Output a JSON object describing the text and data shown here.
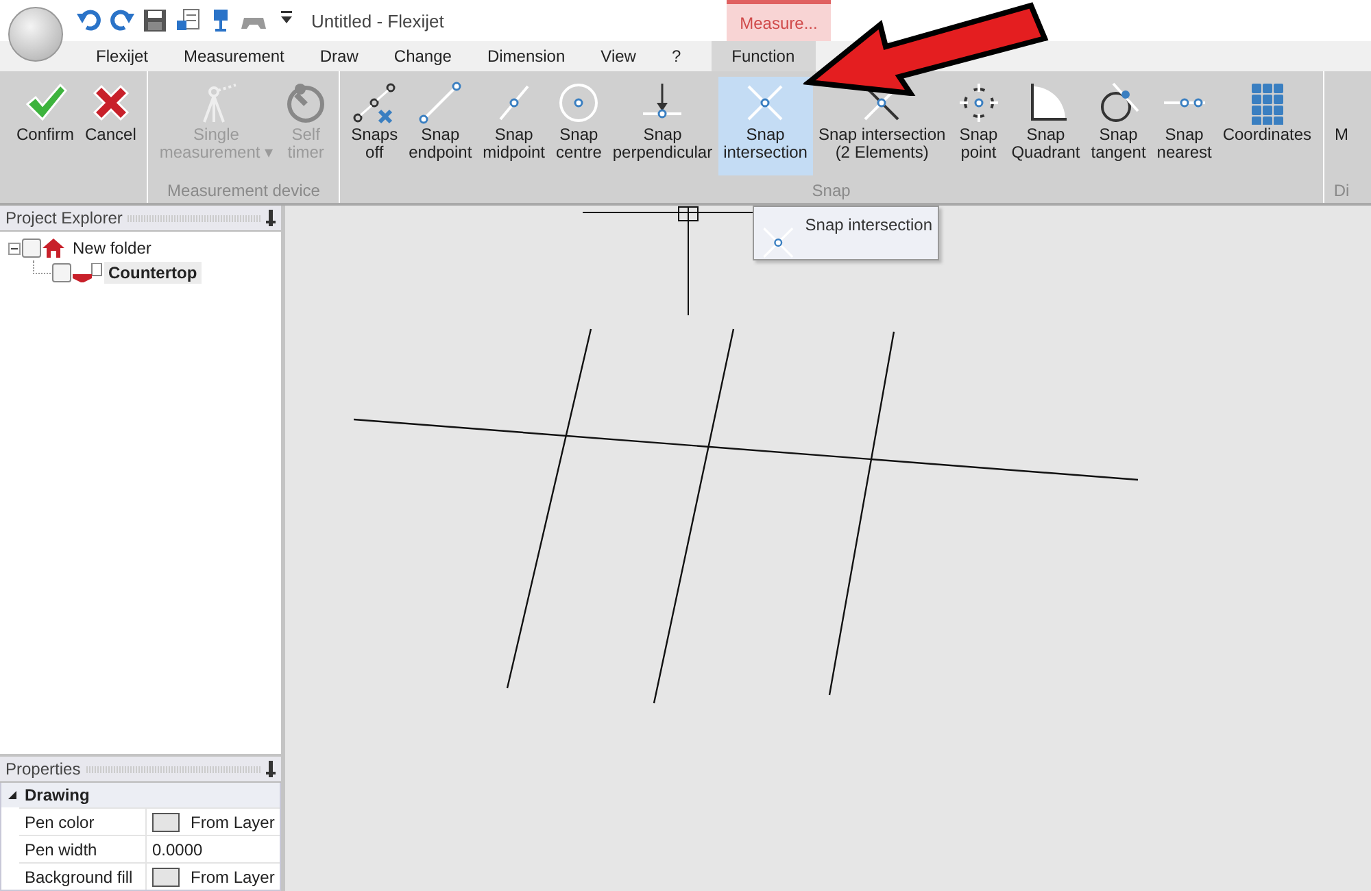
{
  "window": {
    "title": "Untitled -  Flexijet"
  },
  "contextual_tab": {
    "label": "Measure..."
  },
  "tabs": [
    {
      "label": "Flexijet",
      "selected": false
    },
    {
      "label": "Measurement",
      "selected": false
    },
    {
      "label": "Draw",
      "selected": false
    },
    {
      "label": "Change",
      "selected": false
    },
    {
      "label": "Dimension",
      "selected": false
    },
    {
      "label": "View",
      "selected": false
    },
    {
      "label": "?",
      "selected": false
    },
    {
      "label": "Function",
      "selected": true
    }
  ],
  "ribbon_groups": [
    {
      "buttons": [
        {
          "label": "Confirm",
          "disabled": false,
          "selected": false
        },
        {
          "label": "Cancel",
          "disabled": false,
          "selected": false
        }
      ]
    },
    {
      "label": "Measurement device",
      "buttons": [
        {
          "label": "Single\nmeasurement ▾",
          "disabled": true,
          "selected": false
        },
        {
          "label": "Self\ntimer",
          "disabled": true,
          "selected": false
        }
      ]
    },
    {
      "label": "Snap",
      "buttons": [
        {
          "label": "Snaps\noff",
          "disabled": false,
          "selected": false
        },
        {
          "label": "Snap\nendpoint",
          "disabled": false,
          "selected": false
        },
        {
          "label": "Snap\nmidpoint",
          "disabled": false,
          "selected": false
        },
        {
          "label": "Snap\ncentre",
          "disabled": false,
          "selected": false
        },
        {
          "label": "Snap\nperpendicular",
          "disabled": false,
          "selected": false
        },
        {
          "label": "Snap\nintersection",
          "disabled": false,
          "selected": true
        },
        {
          "label": "Snap intersection\n(2 Elements)",
          "disabled": false,
          "selected": false
        },
        {
          "label": "Snap\npoint",
          "disabled": false,
          "selected": false
        },
        {
          "label": "Snap\nQuadrant",
          "disabled": false,
          "selected": false
        },
        {
          "label": "Snap\ntangent",
          "disabled": false,
          "selected": false
        },
        {
          "label": "Snap\nnearest",
          "disabled": false,
          "selected": false
        },
        {
          "label": "Coordinates",
          "disabled": false,
          "selected": false
        }
      ]
    },
    {
      "label": "Di",
      "buttons": [
        {
          "label": "M",
          "disabled": false,
          "selected": false
        }
      ]
    }
  ],
  "project_explorer": {
    "title": "Project Explorer",
    "tree": [
      {
        "label": "New folder",
        "checked": false,
        "expanded": true,
        "selected": false,
        "children": [
          {
            "label": "Countertop",
            "checked": false,
            "selected": true
          }
        ]
      }
    ]
  },
  "properties": {
    "title": "Properties",
    "category": {
      "label": "Drawing",
      "expanded": true
    },
    "rows": [
      {
        "name": "Pen color",
        "kind": "color",
        "value": "From Layer"
      },
      {
        "name": "Pen width",
        "kind": "text",
        "value": "0.0000"
      },
      {
        "name": "Background fill",
        "kind": "color",
        "value": "From Layer"
      }
    ]
  },
  "tooltip": {
    "text": "Snap intersection"
  }
}
